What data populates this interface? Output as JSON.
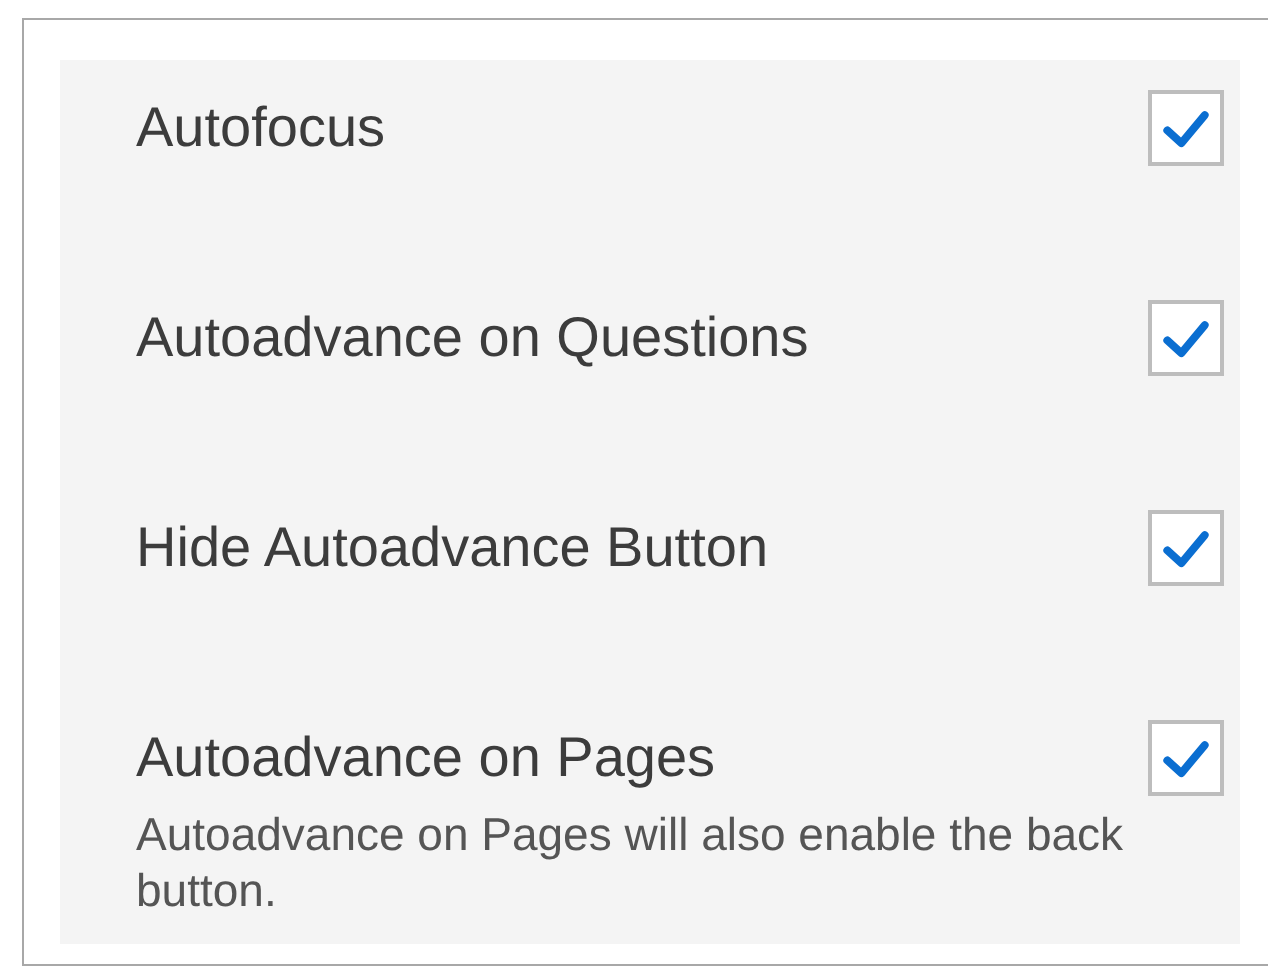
{
  "options": [
    {
      "label": "Autofocus",
      "checked": true
    },
    {
      "label": "Autoadvance on Questions",
      "checked": true
    },
    {
      "label": "Hide Autoadvance Button",
      "checked": true
    },
    {
      "label": "Autoadvance on Pages",
      "checked": true,
      "description": "Autoadvance on Pages will also enable the back button."
    }
  ]
}
